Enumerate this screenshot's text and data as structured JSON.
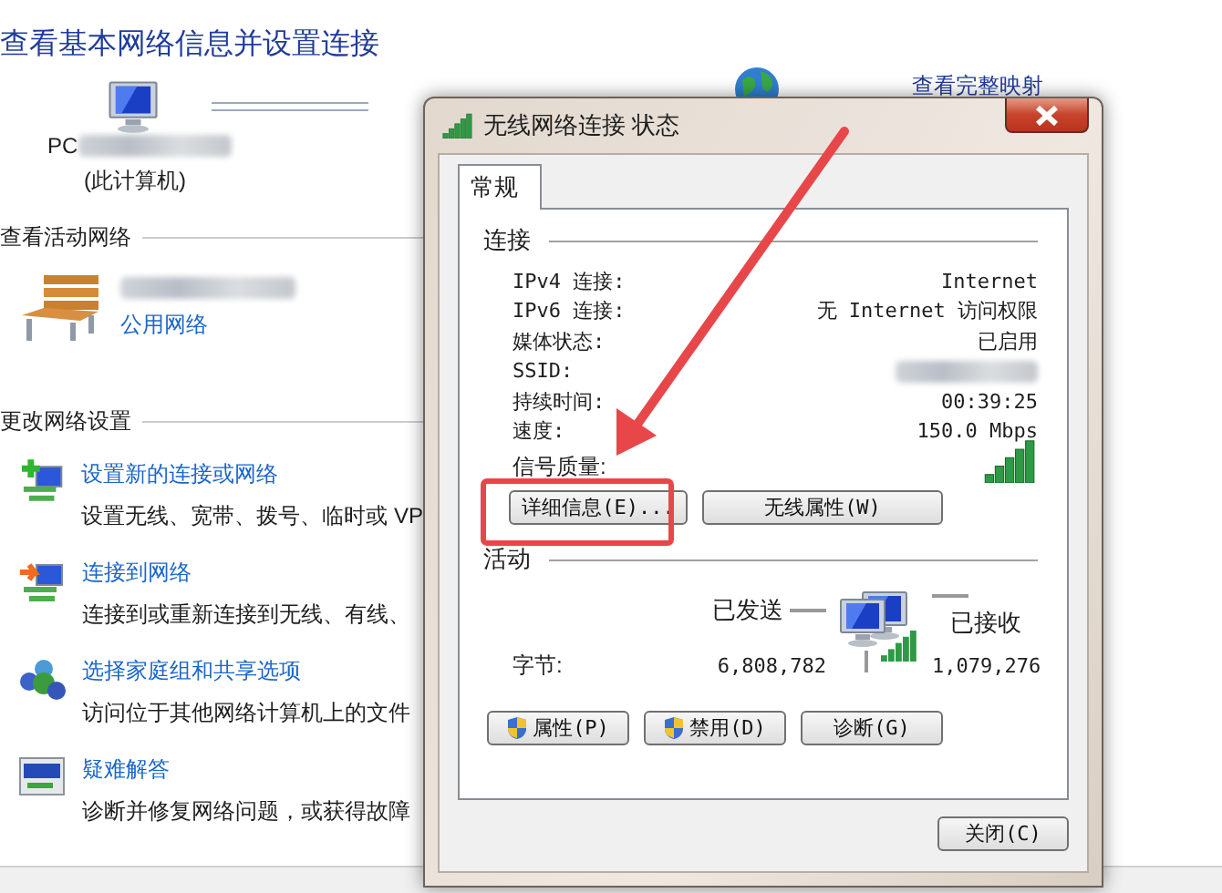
{
  "network_center": {
    "title": "查看基本网络信息并设置连接",
    "computer_name_prefix": "PC",
    "computer_caption": "(此计算机)",
    "full_map_link": "查看完整映射",
    "active_networks": {
      "heading": "查看活动网络",
      "network_type": "公用网络"
    },
    "change_settings": {
      "heading": "更改网络设置",
      "tasks": [
        {
          "kind": "new-connection",
          "title": "设置新的连接或网络",
          "description": "设置无线、宽带、拨号、临时或 VP"
        },
        {
          "kind": "connect",
          "title": "连接到网络",
          "description": "连接到或重新连接到无线、有线、"
        },
        {
          "kind": "homegroup",
          "title": "选择家庭组和共享选项",
          "description": "访问位于其他网络计算机上的文件"
        },
        {
          "kind": "troubleshoot",
          "title": "疑难解答",
          "description": "诊断并修复网络问题，或获得故障"
        }
      ]
    }
  },
  "dialog": {
    "title": "无线网络连接 状态",
    "tabs": [
      {
        "label": "常规",
        "selected": true
      }
    ],
    "connection": {
      "heading": "连接",
      "rows": [
        {
          "label": "IPv4 连接:",
          "value": "Internet"
        },
        {
          "label": "IPv6 连接:",
          "value": "无 Internet 访问权限"
        },
        {
          "label": "媒体状态:",
          "value": "已启用"
        },
        {
          "label": "SSID:"
        },
        {
          "label": "持续时间:",
          "value": "00:39:25"
        },
        {
          "label": "速度:",
          "value": "150.0 Mbps"
        }
      ],
      "signal_label": "信号质量:"
    },
    "connection_buttons": [
      "详细信息(E)...",
      "无线属性(W)"
    ],
    "activity": {
      "heading": "活动",
      "sent_label": "已发送",
      "received_label": "已接收",
      "bytes_label": "字节:",
      "bytes_sent": "6,808,782",
      "bytes_received": "1,079,276"
    },
    "action_buttons": [
      {
        "label": "属性(P)",
        "kind": "shield"
      },
      {
        "label": "禁用(D)",
        "kind": "shield"
      },
      {
        "label": "诊断(G)",
        "kind": "plain"
      }
    ],
    "close_button": "关闭(C)"
  }
}
